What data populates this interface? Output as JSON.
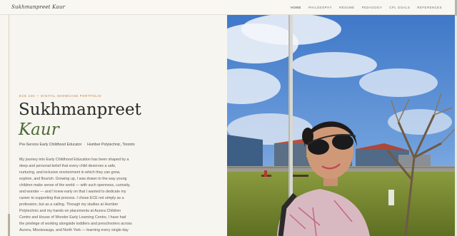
{
  "header": {
    "brand": "Sukhmanpreet Kaur",
    "nav": [
      "HOME",
      "PHILOSOPHY",
      "RÉSUMÉ",
      "PEDAGOGY",
      "CPL GOALS",
      "REFERENCES"
    ]
  },
  "hero": {
    "eyebrow": "ECE 245 — DIGITAL SHOWCASE PORTFOLIO",
    "first_name": "Sukhmanpreet",
    "last_name": "Kaur",
    "role": "Pre-Service Early Childhood Educator",
    "school": "Humber Polytechnic, Toronto",
    "bio": "My journey into Early Childhood Education has been shaped by a deep and personal belief that every child deserves a safe, nurturing, and inclusive environment in which they can grow, explore, and flourish. Growing up, I was drawn to the way young children make sense of the world — with such openness, curiosity, and wonder — and I knew early on that I wanted to dedicate my career to supporting that process. I chose ECE not simply as a profession, but as a calling. Through my studies at Humber Polytechnic and my hands-on placements at Aurora Children Centre and House of Wonder Early Learning Centre, I have had the privilege of working alongside toddlers and preschoolers across Aurora, Mississauga, and North York — learning every single day"
  },
  "colors": {
    "background": "#f7f5ef",
    "accent_green": "#4a6a36",
    "eyebrow_orange": "#b87a3a"
  }
}
